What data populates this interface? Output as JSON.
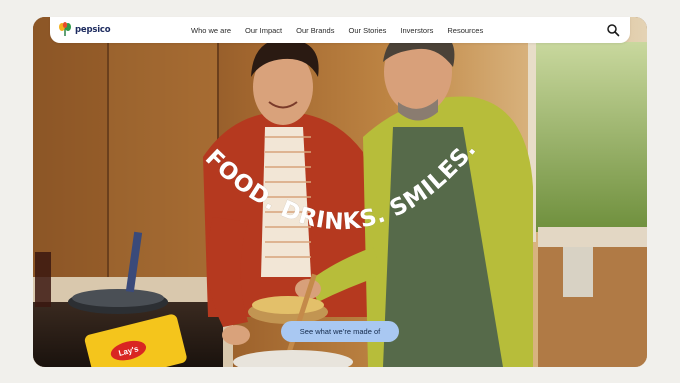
{
  "brand": {
    "name": "pepsico",
    "logo_icon": "pepsico-leaf-logo",
    "color": "#1d2b5f"
  },
  "nav": {
    "items": [
      {
        "label": "Who we are"
      },
      {
        "label": "Our Impact"
      },
      {
        "label": "Our Brands"
      },
      {
        "label": "Our Stories"
      },
      {
        "label": "Inverstors"
      },
      {
        "label": "Resources"
      }
    ],
    "search_icon": "search-icon"
  },
  "hero": {
    "headline": "FOOD. DRINKS. SMILES.",
    "cta_label": "See what we’re made of",
    "cta_color": "#a9c8f2",
    "chip_bag_text": "Lay's"
  }
}
